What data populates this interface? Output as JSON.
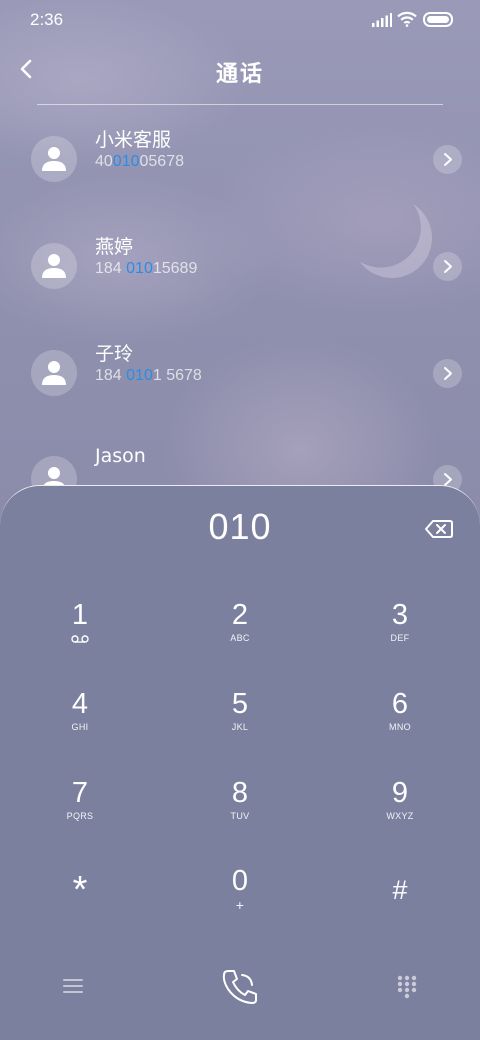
{
  "status_bar": {
    "time": "2:36"
  },
  "header": {
    "title": "通话"
  },
  "contacts": [
    {
      "name": "小米客服",
      "number_pre": "40",
      "number_match": "010",
      "number_post": "05678"
    },
    {
      "name": "燕婷",
      "number_pre": "184 ",
      "number_match": "010",
      "number_post": "15689"
    },
    {
      "name": "子玲",
      "number_pre": "184 ",
      "number_match": "010",
      "number_post": "1 5678"
    },
    {
      "name": "Jason",
      "number_pre": "",
      "number_match": "",
      "number_post": ""
    }
  ],
  "dialer": {
    "input": "010",
    "keys": [
      {
        "digit": "1",
        "letters": ""
      },
      {
        "digit": "2",
        "letters": "ABC"
      },
      {
        "digit": "3",
        "letters": "DEF"
      },
      {
        "digit": "4",
        "letters": "GHI"
      },
      {
        "digit": "5",
        "letters": "JKL"
      },
      {
        "digit": "6",
        "letters": "MNO"
      },
      {
        "digit": "7",
        "letters": "PQRS"
      },
      {
        "digit": "8",
        "letters": "TUV"
      },
      {
        "digit": "9",
        "letters": "WXYZ"
      },
      {
        "digit": "*",
        "letters": ""
      },
      {
        "digit": "0",
        "letters": "+"
      },
      {
        "digit": "#",
        "letters": ""
      }
    ]
  },
  "icons": {
    "back": "chevron-left-icon",
    "backspace": "backspace-icon",
    "voicemail": "voicemail-icon",
    "menu": "menu-icon",
    "call": "phone-icon",
    "keypad": "keypad-icon"
  },
  "colors": {
    "highlight": "#2c8ce6",
    "dialer_bg": "#7c809f"
  }
}
